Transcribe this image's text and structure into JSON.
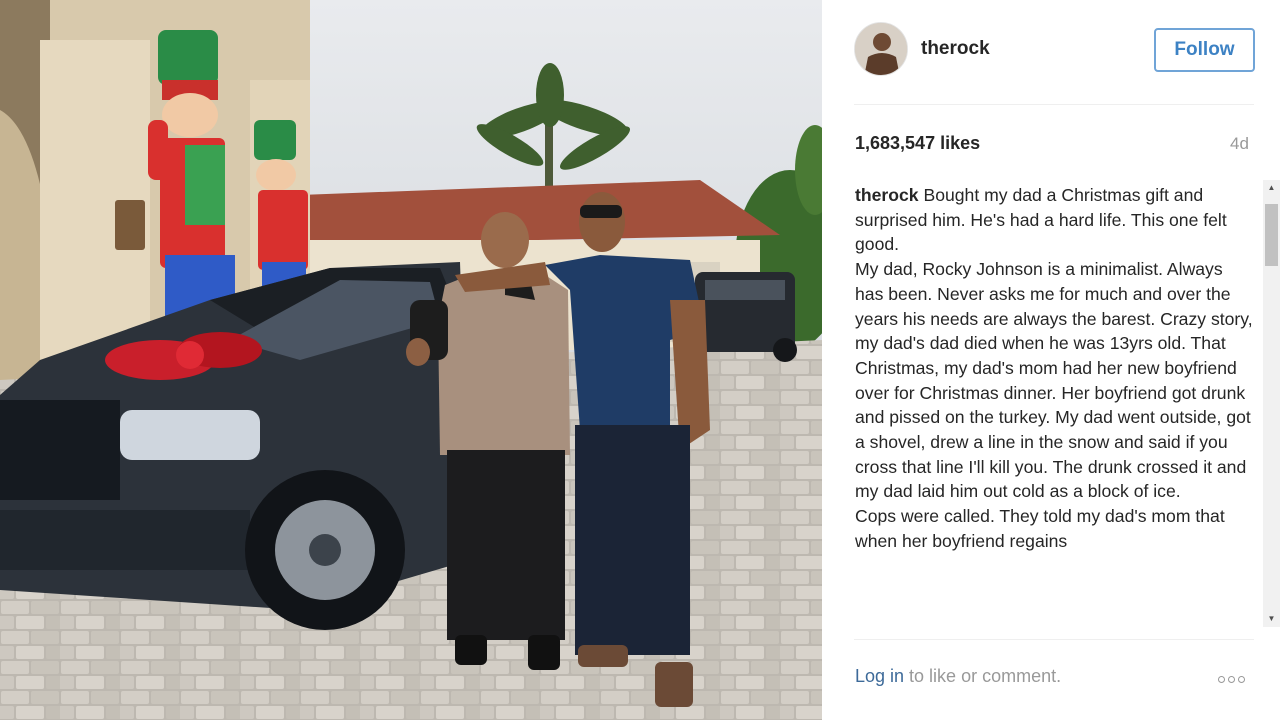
{
  "post": {
    "username": "therock",
    "follow_label": "Follow",
    "likes": "1,683,547 likes",
    "age": "4d",
    "caption_user": "therock",
    "caption_text": "Bought my dad a Christmas gift and surprised him. He's had a hard life. This one felt good.\nMy dad, Rocky Johnson is a minimalist. Always has been. Never asks me for much and over the years his needs are always the barest. Crazy story, my dad's dad died when he was 13yrs old. That Christmas, my dad's mom had her new boyfriend over for Christmas dinner. Her boyfriend got drunk and pissed on the turkey. My dad went outside, got a shovel, drew a line in the snow and said if you cross that line I'll kill you. The drunk crossed it and my dad laid him out cold as a block of ice.\nCops were called. They told my dad's mom that when her boyfriend regains",
    "login_label": "Log in",
    "comment_prompt": " to like or comment.",
    "more_icon": "more-options-icon"
  },
  "colors": {
    "follow_blue": "#3d82c4",
    "link_blue": "#3d6a99",
    "muted_gray": "#999999"
  }
}
